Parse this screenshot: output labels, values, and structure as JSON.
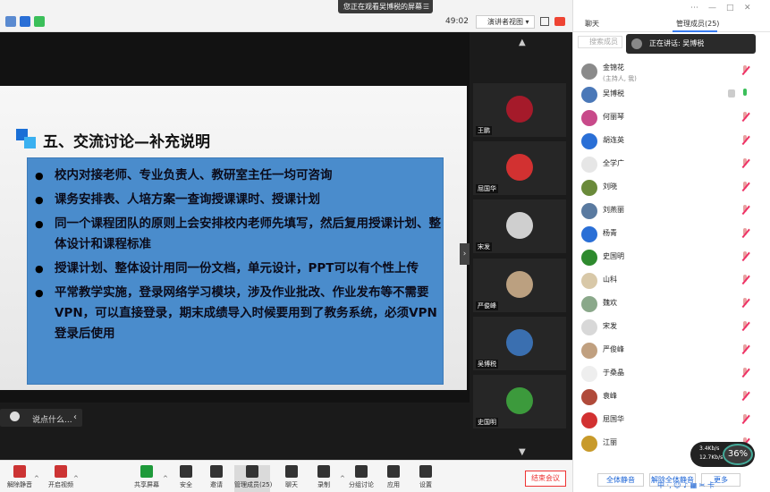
{
  "window": {
    "sharing_banner": "您正在观看吴博税的屏幕",
    "timer": "49:02",
    "view_mode": "演讲者视图"
  },
  "slide": {
    "title": "五、交流讨论—补充说明",
    "bullets": [
      "校内对接老师、专业负责人、教研室主任一均可咨询",
      "课务安排表、人培方案一查询授课课时、授课计划",
      "同一个课程团队的原则上会安排校内老师先填写，然后复用授课计划、整体设计和课程标准",
      "授课计划、整体设计用同一份文档，单元设计，PPT可以有个性上传",
      "平常教学实施，登录网络学习模块，涉及作业批改、作业发布等不需要VPN，可以直接登录，期末成绩导入时候要用到了教务系统，必须VPN登录后使用"
    ]
  },
  "chat": {
    "placeholder": "说点什么..."
  },
  "video_tiles": [
    {
      "name": "王鹏",
      "color": "#a51a2a"
    },
    {
      "name": "屈国华",
      "color": "#d23131"
    },
    {
      "name": "宋发",
      "color": "#cfcfcf"
    },
    {
      "name": "严俊峰",
      "color": "#bba080"
    },
    {
      "name": "吴博税",
      "color": "#3a6fb0"
    },
    {
      "name": "史国明",
      "color": "#3c9a3c"
    }
  ],
  "right_panel": {
    "tab_chat": "聊天",
    "tab_members": "管理成员(25)",
    "search_placeholder": "搜索成员",
    "speaking_tip": "正在讲话: 吴博税",
    "members": [
      {
        "name": "金锦花",
        "sub": "(主持人, 我)",
        "color": "#8a8a8a",
        "mic": "off"
      },
      {
        "name": "吴博税",
        "sub": "",
        "color": "#4a78b8",
        "mic": "on"
      },
      {
        "name": "何丽琴",
        "sub": "",
        "color": "#c84a8a",
        "mic": "off"
      },
      {
        "name": "胡连英",
        "sub": "",
        "color": "#2a6fd6",
        "mic": "off"
      },
      {
        "name": "全学广",
        "sub": "",
        "color": "#e6e6e6",
        "mic": "off"
      },
      {
        "name": "刘晓",
        "sub": "",
        "color": "#6a8a3a",
        "mic": "off"
      },
      {
        "name": "刘燕丽",
        "sub": "",
        "color": "#5a7aa0",
        "mic": "off"
      },
      {
        "name": "杨青",
        "sub": "",
        "color": "#2a6fd6",
        "mic": "off"
      },
      {
        "name": "史国明",
        "sub": "",
        "color": "#2e8a2e",
        "mic": "off"
      },
      {
        "name": "山科",
        "sub": "",
        "color": "#d8c8a8",
        "mic": "off"
      },
      {
        "name": "魏欢",
        "sub": "",
        "color": "#8aa88a",
        "mic": "off"
      },
      {
        "name": "宋发",
        "sub": "",
        "color": "#d8d8d8",
        "mic": "off"
      },
      {
        "name": "严俊峰",
        "sub": "",
        "color": "#c0a080",
        "mic": "off"
      },
      {
        "name": "于桑晶",
        "sub": "",
        "color": "#eeeeee",
        "mic": "off"
      },
      {
        "name": "袁峰",
        "sub": "",
        "color": "#b04a3a",
        "mic": "off"
      },
      {
        "name": "屈国华",
        "sub": "",
        "color": "#d23131",
        "mic": "off"
      },
      {
        "name": "江丽",
        "sub": "",
        "color": "#c89a2a",
        "mic": "off"
      }
    ],
    "btn_mute_all": "全体静音",
    "btn_unmute_all": "解除全体静音",
    "btn_more": "更多",
    "net_up": "3.4Kb/s",
    "net_down": "12.7Kb/s",
    "net_percent": "36%"
  },
  "toolbar": {
    "items": [
      {
        "label": "解除静音"
      },
      {
        "label": "开启视频"
      },
      {
        "label": "共享屏幕"
      },
      {
        "label": "安全"
      },
      {
        "label": "邀请"
      },
      {
        "label": "管理成员(25)"
      },
      {
        "label": "聊天"
      },
      {
        "label": "录制"
      },
      {
        "label": "分组讨论"
      },
      {
        "label": "应用"
      },
      {
        "label": "设置"
      }
    ],
    "end_meeting": "结束会议"
  },
  "taskbar": {
    "ime": "中 ·, ☺ ♪ ▦ ✂ 卡"
  }
}
